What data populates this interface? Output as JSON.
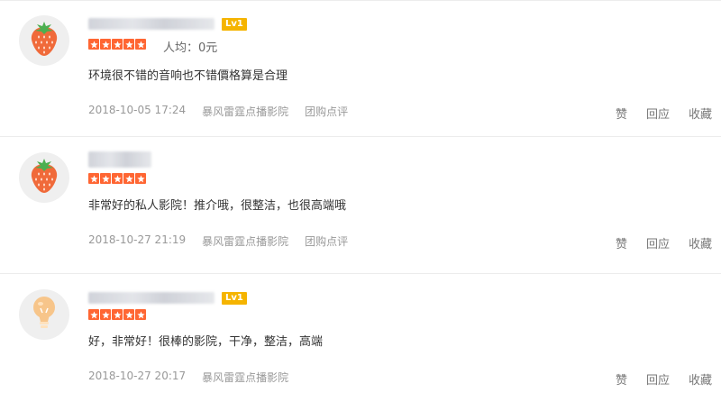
{
  "reviews": [
    {
      "avatar_icon": "strawberry-icon",
      "level": "Lv1",
      "rating": 5,
      "avg_price": "人均：0元",
      "content": "环境很不错的音响也不错價格算是合理",
      "date": "2018-10-05 17:24",
      "shop": "暴风雷霆点播影院",
      "source": "团购点评",
      "actions": [
        "赞",
        "回应",
        "收藏"
      ]
    },
    {
      "avatar_icon": "strawberry-icon",
      "level": "",
      "rating": 5,
      "avg_price": "",
      "content": "非常好的私人影院！推介哦，很整洁，也很高端哦",
      "date": "2018-10-27 21:19",
      "shop": "暴风雷霆点播影院",
      "source": "团购点评",
      "actions": [
        "赞",
        "回应",
        "收藏"
      ]
    },
    {
      "avatar_icon": "lightbulb-icon",
      "level": "Lv1",
      "rating": 5,
      "avg_price": "",
      "content": "好，非常好！很棒的影院，干净，整洁，高端",
      "date": "2018-10-27 20:17",
      "shop": "暴风雷霆点播影院",
      "source": "",
      "actions": [
        "赞",
        "回应",
        "收藏"
      ]
    }
  ],
  "colors": {
    "star": "#ff6633",
    "level_badge": "#f5b400",
    "strawberry": "#f06a3a",
    "lightbulb": "#f7c58a"
  }
}
